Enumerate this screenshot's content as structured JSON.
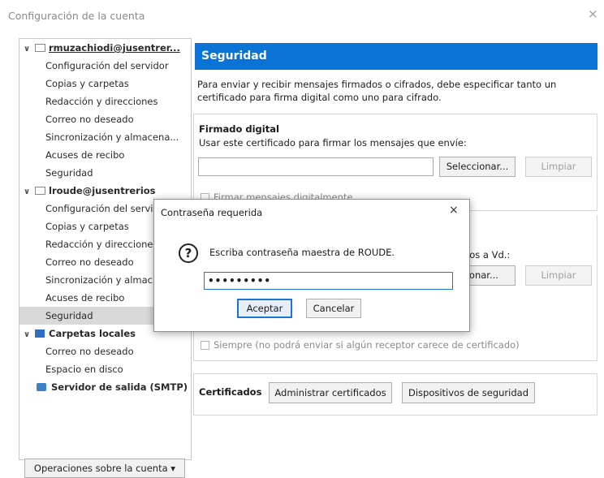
{
  "window": {
    "title": "Configuración de la cuenta",
    "close_glyph": "×"
  },
  "tree": {
    "account1": {
      "name": "rmuzachiodi@jusentrer...",
      "items": [
        "Configuración del servidor",
        "Copias y carpetas",
        "Redacción y direcciones",
        "Correo no deseado",
        "Sincronización y almacena...",
        "Acuses de recibo",
        "Seguridad"
      ]
    },
    "account2": {
      "name": "lroude@jusentrerios",
      "items": [
        "Configuración del servi",
        "Copias y carpetas",
        "Redacción y direccione",
        "Correo no deseado",
        "Sincronización y almac",
        "Acuses de recibo",
        "Seguridad"
      ]
    },
    "local": {
      "name": "Carpetas locales",
      "items": [
        "Correo no deseado",
        "Espacio en disco"
      ]
    },
    "smtp": {
      "name": "Servidor de salida (SMTP)"
    },
    "selected_item": "account2.Seguridad"
  },
  "ops_button": "Operaciones sobre la cuenta ▾",
  "panel": {
    "header": "Seguridad",
    "header_color": "#0b72d6",
    "description": "Para enviar y recibir mensajes firmados o cifrados, debe especificar tanto un certificado para firma digital como uno para cifrado.",
    "signing": {
      "title": "Firmado digital",
      "label": "Usar este certificado para firmar los mensajes que envíe:",
      "value": "",
      "select": "Seleccionar...",
      "clear": "Limpiar",
      "checkbox": "Firmar mensajes digitalmente"
    },
    "encryption": {
      "partial_label": "los a Vd.:",
      "select_partial": "ccionar...",
      "clear": "Limpiar",
      "always": "Siempre (no podrá enviar si algún receptor carece de certificado)"
    },
    "certs": {
      "title": "Certificados",
      "manage": "Administrar certificados",
      "devices": "Dispositivos de seguridad"
    }
  },
  "dialog": {
    "title": "Contraseña requerida",
    "close_glyph": "×",
    "question_glyph": "?",
    "message": "Escriba contraseña maestra de ROUDE.",
    "password_masked": "•••••••••",
    "ok": "Aceptar",
    "cancel": "Cancelar"
  }
}
